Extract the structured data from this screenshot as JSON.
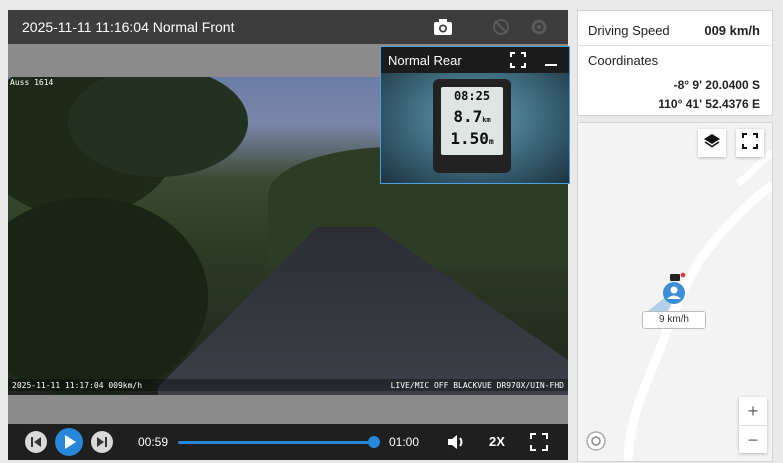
{
  "player": {
    "title": "2025-11-11 11:16:04 Normal Front",
    "osd_top_left": "Auss 1614",
    "osd_timestamp": "2025-11-11 11:17:04 009km/h",
    "osd_device": "LIVE/MIC OFF BLACKVUE DR970X/UIN-FHD",
    "icons": [
      "camera-icon",
      "no-signal-icon",
      "settings-icon"
    ]
  },
  "rear": {
    "title": "Normal Rear",
    "gauge_time": "08:25",
    "gauge_dist": "8.7",
    "gauge_dist_unit": "km",
    "gauge_value": "1.50",
    "gauge_value_unit": "m"
  },
  "controls": {
    "current_time": "00:59",
    "end_time": "01:00",
    "progress": 0.98,
    "speed": "2X"
  },
  "info": {
    "speed_label": "Driving Speed",
    "speed_value": "009 km/h",
    "coord_label": "Coordinates",
    "lat": "-8° 9' 20.0400 S",
    "lon": "110° 41' 52.4376 E"
  },
  "map": {
    "chip": "9 km/h",
    "zoom_in": "+",
    "zoom_out": "−"
  },
  "colors": {
    "accent": "#2787d8",
    "marker": "#3a8fd8",
    "pip_border": "#4aa3df"
  }
}
